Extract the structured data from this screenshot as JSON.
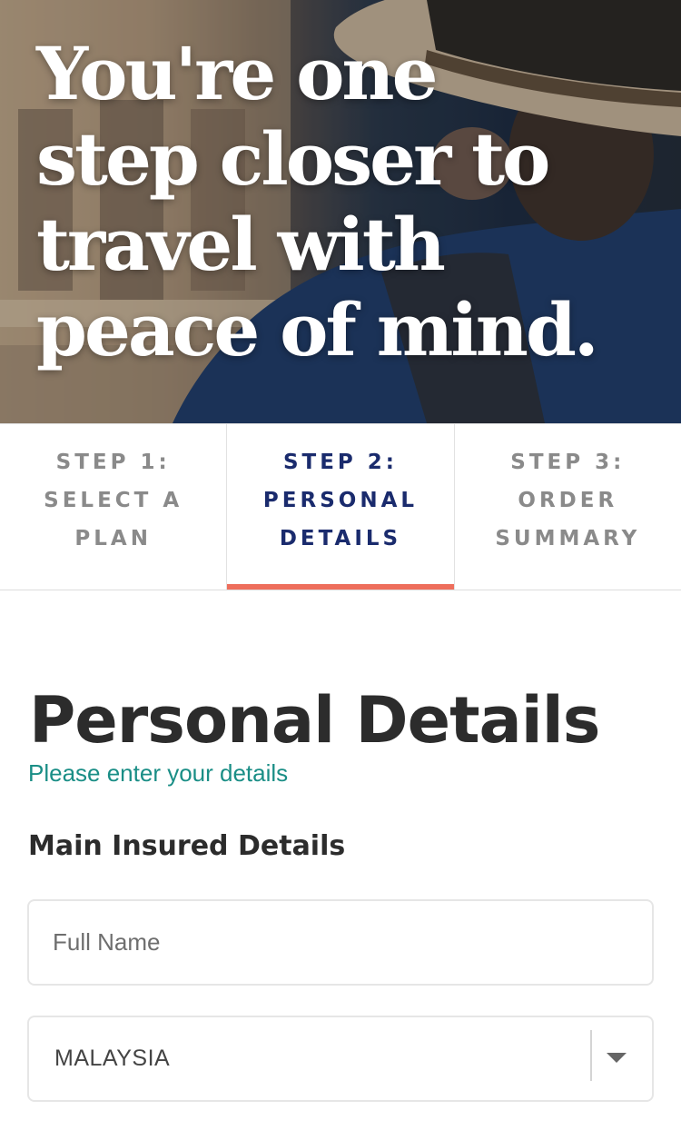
{
  "hero": {
    "title": "You're one step closer to travel with peace of mind."
  },
  "steps": [
    {
      "label": "STEP 1: SELECT A PLAN",
      "active": false
    },
    {
      "label": "STEP 2: PERSONAL DETAILS",
      "active": true
    },
    {
      "label": "STEP 3: ORDER SUMMARY",
      "active": false
    }
  ],
  "main": {
    "title": "Personal Details",
    "subtitle": "Please enter your details",
    "section_title": "Main Insured Details",
    "full_name": {
      "value": "",
      "placeholder": "Full Name"
    },
    "country": {
      "selected": "MALAYSIA"
    }
  },
  "colors": {
    "active_step_text": "#1a2b6d",
    "active_step_underline": "#ee6e5c",
    "subtitle": "#1a8e86"
  }
}
